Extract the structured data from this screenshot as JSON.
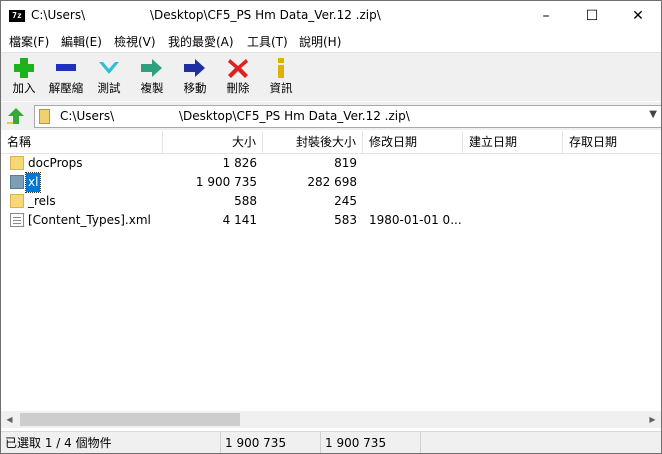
{
  "window": {
    "title": "C:\\Users\\                 \\Desktop\\CF5_PS Hm Data_Ver.12 .zip\\",
    "app_icon_text": "7z",
    "controls": {
      "minimize": "–",
      "maximize": "☐",
      "close": "✕"
    }
  },
  "menu": {
    "items": [
      "檔案(F)",
      "編輯(E)",
      "檢視(V)",
      "我的最愛(A)",
      "工具(T)",
      "說明(H)"
    ]
  },
  "toolbar": {
    "items": [
      {
        "label": "加入",
        "icon": "plus-icon",
        "color": "#1db31d"
      },
      {
        "label": "解壓縮",
        "icon": "minus-icon",
        "color": "#1f2fbf"
      },
      {
        "label": "測試",
        "icon": "check-icon",
        "color": "#2fbfd0"
      },
      {
        "label": "複製",
        "icon": "copy-arrow-icon",
        "color": "#2f9f7f"
      },
      {
        "label": "移動",
        "icon": "move-arrow-icon",
        "color": "#1f2f9f"
      },
      {
        "label": "刪除",
        "icon": "delete-x-icon",
        "color": "#e01f1f"
      },
      {
        "label": "資訊",
        "icon": "info-icon",
        "color": "#e0b000"
      }
    ]
  },
  "address": {
    "path": "C:\\Users\\                 \\Desktop\\CF5_PS Hm Data_Ver.12 .zip\\"
  },
  "columns": [
    "名稱",
    "大小",
    "封裝後大小",
    "修改日期",
    "建立日期",
    "存取日期"
  ],
  "files": [
    {
      "name": "docProps",
      "size": "1 826",
      "packed": "819",
      "modified": "",
      "type": "folder",
      "selected": false
    },
    {
      "name": "xl",
      "size": "1 900 735",
      "packed": "282 698",
      "modified": "",
      "type": "folder",
      "selected": true
    },
    {
      "name": "_rels",
      "size": "588",
      "packed": "245",
      "modified": "",
      "type": "folder",
      "selected": false
    },
    {
      "name": "[Content_Types].xml",
      "size": "4 141",
      "packed": "583",
      "modified": "1980-01-01 0...",
      "type": "file",
      "selected": false
    }
  ],
  "scrollbar": {
    "left_arrow": "◀",
    "right_arrow": "▶"
  },
  "status": {
    "selection": "已選取 1 / 4 個物件",
    "size": "1 900 735",
    "packed": "1 900 735"
  }
}
